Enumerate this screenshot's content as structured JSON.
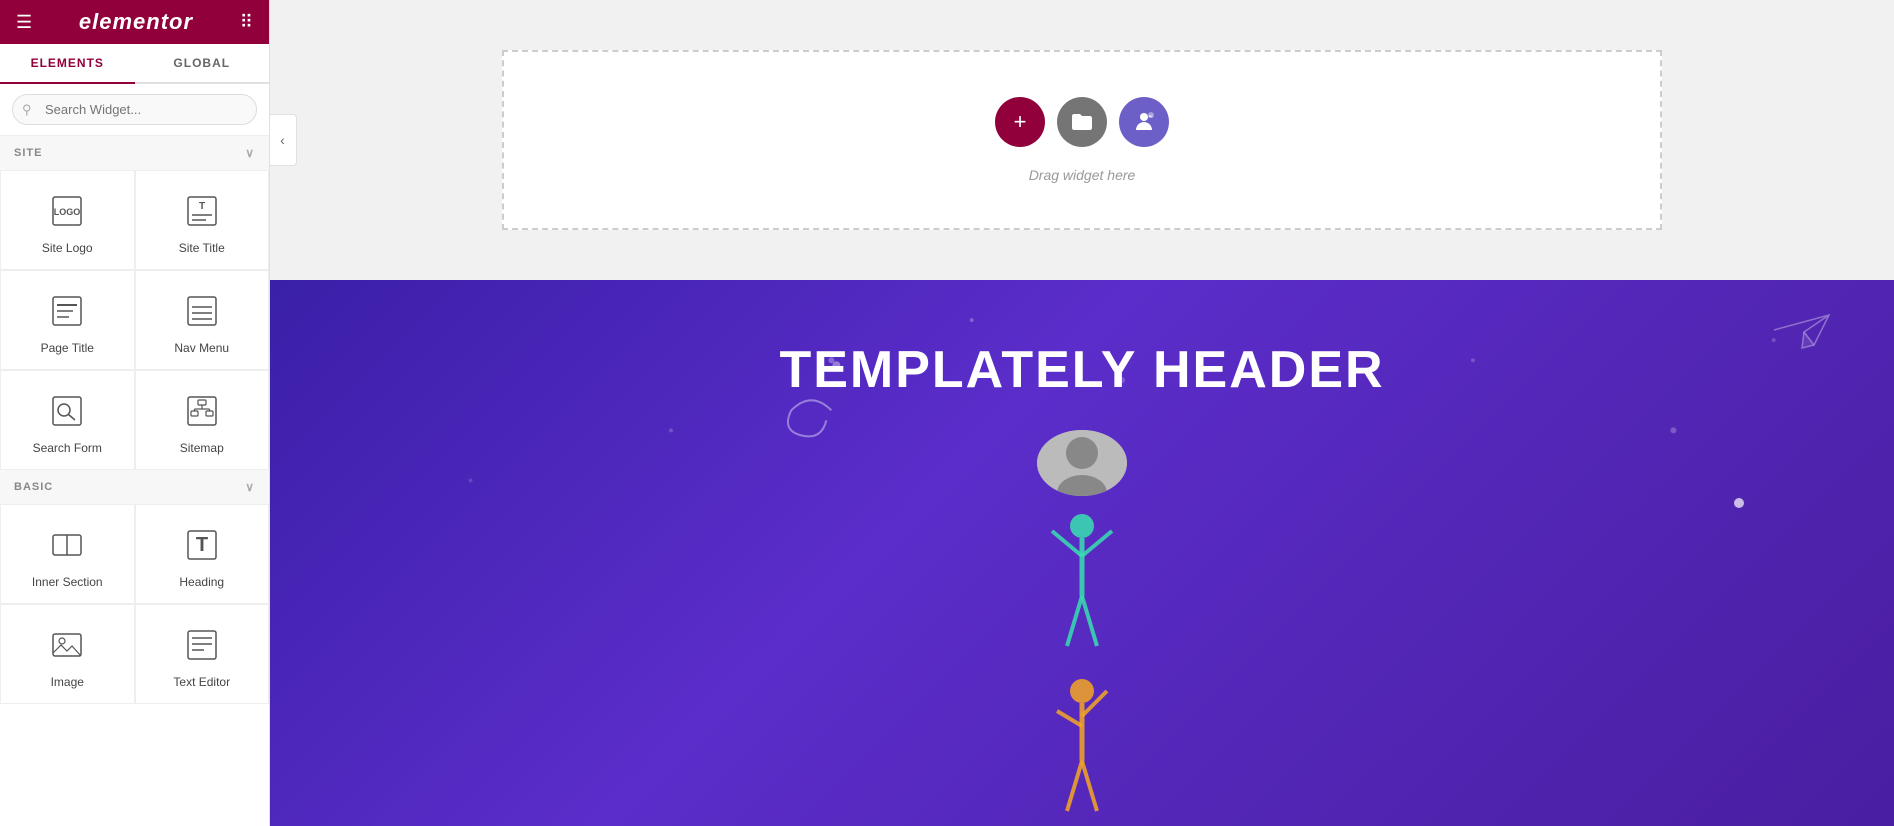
{
  "header": {
    "logo": "elementor",
    "hamburger_label": "☰",
    "grid_label": "⠿"
  },
  "sidebar": {
    "tabs": [
      {
        "id": "elements",
        "label": "ELEMENTS",
        "active": true
      },
      {
        "id": "global",
        "label": "GLOBAL",
        "active": false
      }
    ],
    "search_placeholder": "Search Widget...",
    "sections": [
      {
        "id": "site",
        "label": "SITE",
        "expanded": true,
        "widgets": [
          {
            "id": "site-logo",
            "label": "Site Logo"
          },
          {
            "id": "site-title",
            "label": "Site Title"
          },
          {
            "id": "page-title",
            "label": "Page Title"
          },
          {
            "id": "nav-menu",
            "label": "Nav Menu"
          },
          {
            "id": "search-form",
            "label": "Search Form"
          },
          {
            "id": "sitemap",
            "label": "Sitemap"
          }
        ]
      },
      {
        "id": "basic",
        "label": "BASIC",
        "expanded": true,
        "widgets": [
          {
            "id": "inner-section",
            "label": "Inner Section"
          },
          {
            "id": "heading",
            "label": "Heading"
          },
          {
            "id": "image",
            "label": "Image"
          },
          {
            "id": "text-editor",
            "label": "Text Editor"
          }
        ]
      }
    ]
  },
  "drop_zone": {
    "drag_text": "Drag widget here",
    "buttons": [
      {
        "id": "plus",
        "icon": "+",
        "color": "#92003b",
        "label": "Add Widget"
      },
      {
        "id": "folder",
        "icon": "▣",
        "color": "#757575",
        "label": "Template Library"
      },
      {
        "id": "person",
        "icon": "👤",
        "color": "#6c5fc7",
        "label": "AI Widget"
      }
    ]
  },
  "hero": {
    "title": "TEMPLATELY HEADER"
  },
  "toggle": {
    "arrow": "‹"
  }
}
